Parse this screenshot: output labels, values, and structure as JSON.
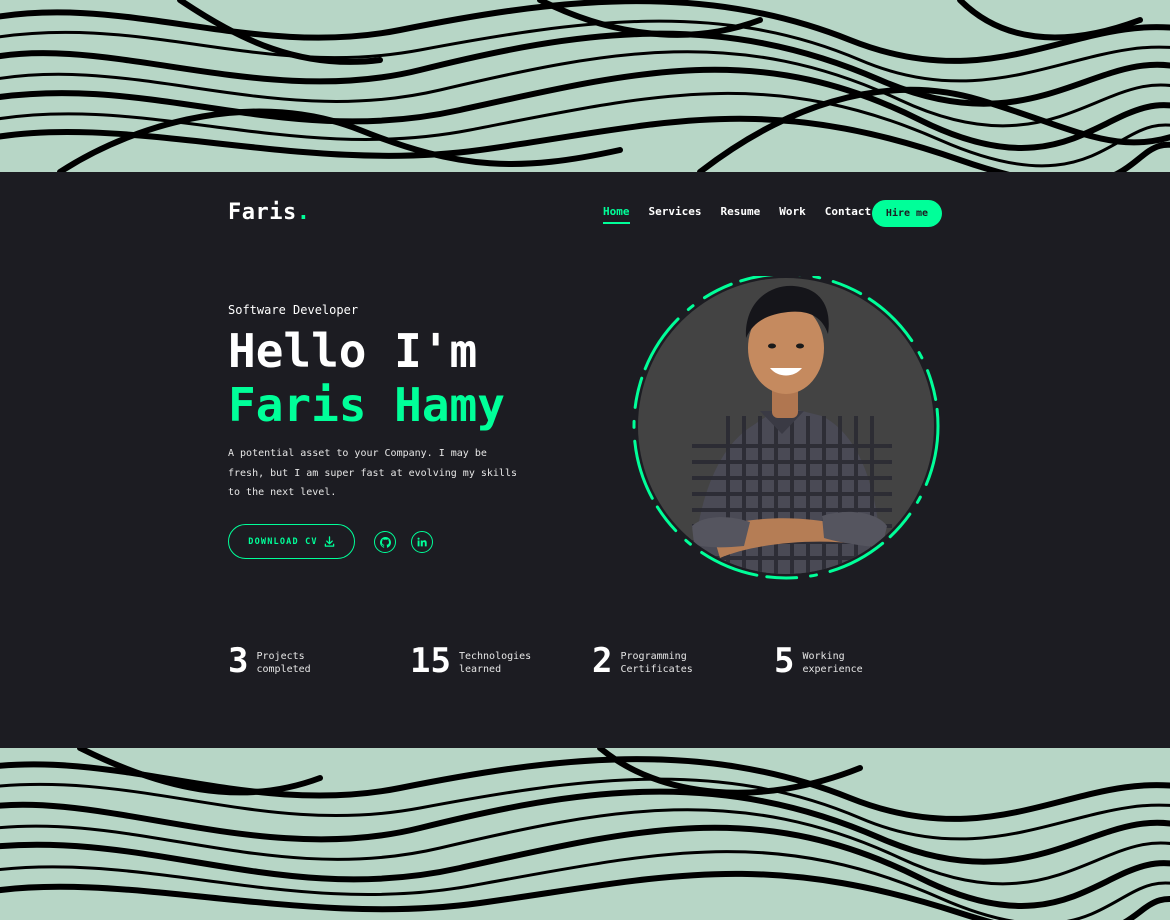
{
  "brand": {
    "name": "Faris",
    "dot": ".",
    "accent_color": "#00ff99",
    "panel_color": "#1c1c22",
    "background_color": "#b7d6c6"
  },
  "nav": {
    "items": [
      {
        "label": "Home",
        "active": true
      },
      {
        "label": "Services",
        "active": false
      },
      {
        "label": "Resume",
        "active": false
      },
      {
        "label": "Work",
        "active": false
      },
      {
        "label": "Contact",
        "active": false
      }
    ],
    "cta_label": "Hire me"
  },
  "hero": {
    "role": "Software Developer",
    "greeting": "Hello I'm",
    "name": "Faris Hamy",
    "description": "A potential asset to your Company. I may be fresh, but I am super fast at evolving my skills to the next level.",
    "download_label": "DOWNLOAD CV",
    "download_icon": "download-icon",
    "socials": [
      {
        "name": "github-icon"
      },
      {
        "name": "linkedin-icon"
      }
    ]
  },
  "stats": [
    {
      "value": "3",
      "label": "Projects completed"
    },
    {
      "value": "15",
      "label": "Technologies learned"
    },
    {
      "value": "2",
      "label": "Programming Certificates"
    },
    {
      "value": "5",
      "label": "Working experience"
    }
  ]
}
